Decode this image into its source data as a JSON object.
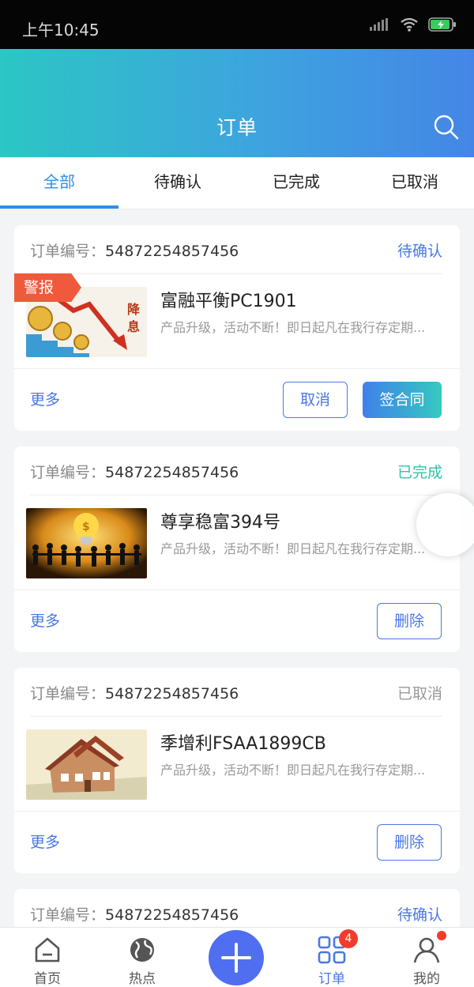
{
  "status_bar": {
    "time": "上午10:45"
  },
  "header": {
    "title": "订单"
  },
  "tabs": [
    {
      "label": "全部",
      "active": true
    },
    {
      "label": "待确认",
      "active": false
    },
    {
      "label": "已完成",
      "active": false
    },
    {
      "label": "已取消",
      "active": false
    }
  ],
  "order_label": "订单编号：",
  "orders": [
    {
      "order_no": "54872254857456",
      "status": "待确认",
      "status_color": "#4a77e6",
      "product": "富融平衡PC1901",
      "desc": "产品升级，活动不断！即日起凡在我行存定期...",
      "thumb_tag": "警报",
      "thumb_text": "降息",
      "more": "更多",
      "actions": [
        "取消",
        "签合同"
      ]
    },
    {
      "order_no": "54872254857456",
      "status": "已完成",
      "status_color": "#2fc3a4",
      "product": "尊享稳富394号",
      "desc": "产品升级，活动不断！即日起凡在我行存定期...",
      "more": "更多",
      "actions": [
        "删除"
      ]
    },
    {
      "order_no": "54872254857456",
      "status": "已取消",
      "status_color": "#999999",
      "product": "季增利FSAA1899CB",
      "desc": "产品升级，活动不断！即日起凡在我行存定期...",
      "more": "更多",
      "actions": [
        "删除"
      ]
    },
    {
      "order_no": "54872254857456",
      "status": "待确认",
      "status_color": "#4a77e6"
    }
  ],
  "bottom_nav": [
    {
      "label": "首页",
      "icon": "home-icon"
    },
    {
      "label": "热点",
      "icon": "globe-icon"
    },
    {
      "label": "",
      "icon": "plus-icon"
    },
    {
      "label": "订单",
      "icon": "grid-icon",
      "badge": "4"
    },
    {
      "label": "我的",
      "icon": "user-icon"
    }
  ],
  "colors": {
    "accent": "#4a77e6",
    "header_start": "#2cc6c4",
    "header_end": "#4486e6",
    "badge": "#f23b2b"
  }
}
